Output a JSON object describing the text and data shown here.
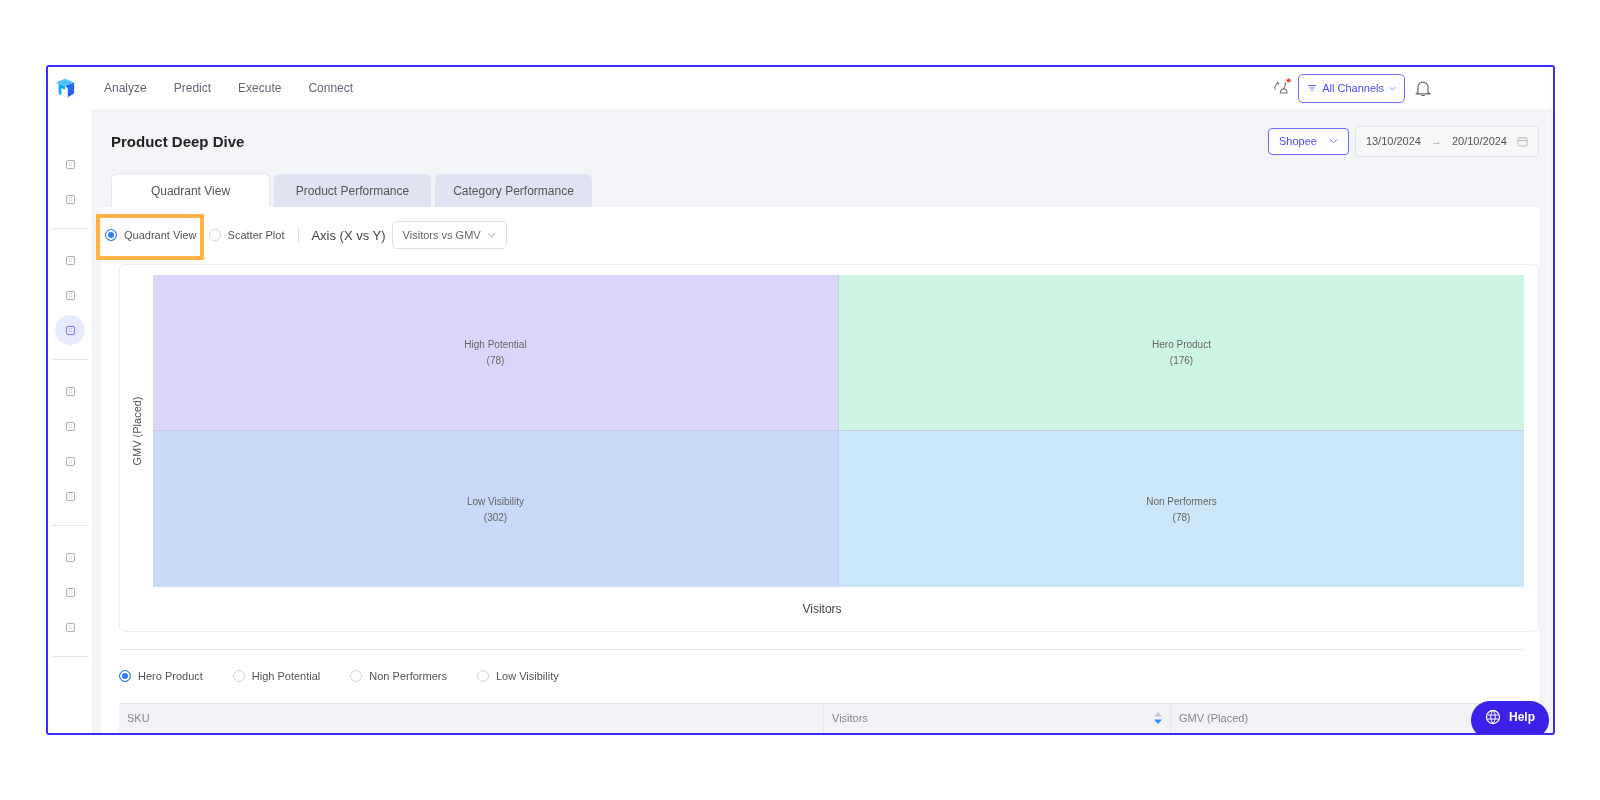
{
  "top_nav": {
    "items": [
      "Analyze",
      "Predict",
      "Execute",
      "Connect"
    ],
    "channel_filter": "All Channels",
    "sync_alert": true
  },
  "sidebar": {
    "groups": [
      [
        {
          "selected": false
        },
        {
          "selected": false
        }
      ],
      [
        {
          "selected": false
        },
        {
          "selected": false
        },
        {
          "selected": true
        }
      ],
      [
        {
          "selected": false
        },
        {
          "selected": false
        },
        {
          "selected": false
        },
        {
          "selected": false
        }
      ],
      [
        {
          "selected": false
        },
        {
          "selected": false
        },
        {
          "selected": false
        }
      ]
    ]
  },
  "page": {
    "title": "Product Deep Dive",
    "marketplace": "Shopee",
    "date_from": "13/10/2024",
    "date_to": "20/10/2024",
    "date_arrow": "→"
  },
  "tabs": [
    {
      "label": "Quadrant View",
      "selected": true
    },
    {
      "label": "Product Performance",
      "selected": false
    },
    {
      "label": "Category Performance",
      "selected": false
    }
  ],
  "view_modes": [
    {
      "label": "Quadrant View",
      "selected": true,
      "highlighted": true
    },
    {
      "label": "Scatter Plot",
      "selected": false,
      "highlighted": false
    }
  ],
  "axis": {
    "label": "Axis (X vs Y)",
    "value": "Visitors vs GMV"
  },
  "quadrants": {
    "y_label": "GMV (Placed)",
    "x_label": "Visitors",
    "cells": [
      {
        "name": "High Potential",
        "count": "(78)",
        "color": "#ddd6fb"
      },
      {
        "name": "Hero Product",
        "count": "(176)",
        "color": "#cdf5e4"
      },
      {
        "name": "Low Visibility",
        "count": "(302)",
        "color": "#c9d9fa"
      },
      {
        "name": "Non Performers",
        "count": "(78)",
        "color": "#cce8f8"
      }
    ]
  },
  "segment_filter": [
    {
      "label": "Hero Product",
      "selected": true
    },
    {
      "label": "High Potential",
      "selected": false
    },
    {
      "label": "Non Performers",
      "selected": false
    },
    {
      "label": "Low Visibility",
      "selected": false
    }
  ],
  "table": {
    "columns": [
      {
        "label": "SKU",
        "sortable": false
      },
      {
        "label": "Visitors",
        "sortable": true
      },
      {
        "label": "GMV (Placed)",
        "sortable": false
      }
    ]
  },
  "help_button": "Help"
}
